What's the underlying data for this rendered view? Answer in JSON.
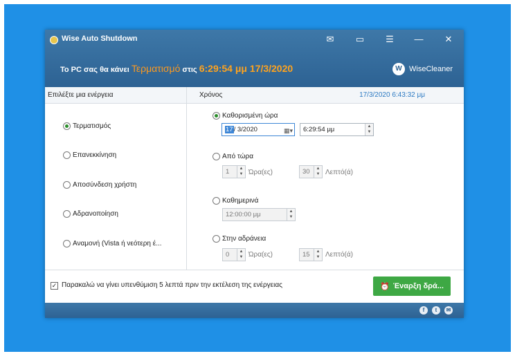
{
  "window": {
    "title": "Wise Auto Shutdown",
    "headline_prefix": "Το PC σας θα κάνει",
    "headline_action": "Τερματισμό",
    "headline_mid": "στις",
    "headline_time": "6:29:54 μμ 17/3/2020",
    "brand_logo_letter": "W",
    "brand_name": "WiseCleaner"
  },
  "icons": {
    "mail": "✉",
    "feedback": "▭",
    "menu": "☰",
    "minimize": "—",
    "close": "✕"
  },
  "left": {
    "header": "Επιλέξτε μια ενέργεια",
    "actions": [
      {
        "label": "Τερματισμός",
        "selected": true
      },
      {
        "label": "Επανεκκίνηση",
        "selected": false
      },
      {
        "label": "Αποσύνδεση χρήστη",
        "selected": false
      },
      {
        "label": "Αδρανοποίηση",
        "selected": false
      },
      {
        "label": "Αναμονή (Vista ή νεότερη έ...",
        "selected": false
      }
    ]
  },
  "right": {
    "header": "Χρόνος",
    "current_datetime": "17/3/2020 6:43:32 μμ",
    "specific_time": {
      "label": "Καθορισμένη ώρα",
      "date_day": "17",
      "date_rest": "/ 3/2020",
      "time": "6:29:54 μμ"
    },
    "from_now": {
      "label": "Από τώρα",
      "hours": "1",
      "hours_unit": "Ώρα(ες)",
      "minutes": "30",
      "minutes_unit": "Λεπτό(ά)"
    },
    "daily": {
      "label": "Καθημερινά",
      "time": "12:00:00 μμ"
    },
    "idle": {
      "label": "Στην αδράνεια",
      "hours": "0",
      "hours_unit": "Ώρα(ες)",
      "minutes": "15",
      "minutes_unit": "Λεπτό(ά)"
    }
  },
  "footer": {
    "reminder_label": "Παρακαλώ να γίνει υπενθύμιση 5 λεπτά πριν την εκτέλεση της ενέργειας",
    "reminder_checked": true,
    "start_button": "Έναρξη δρά..."
  },
  "social": {
    "facebook": "f",
    "twitter": "t",
    "email": "✉"
  }
}
